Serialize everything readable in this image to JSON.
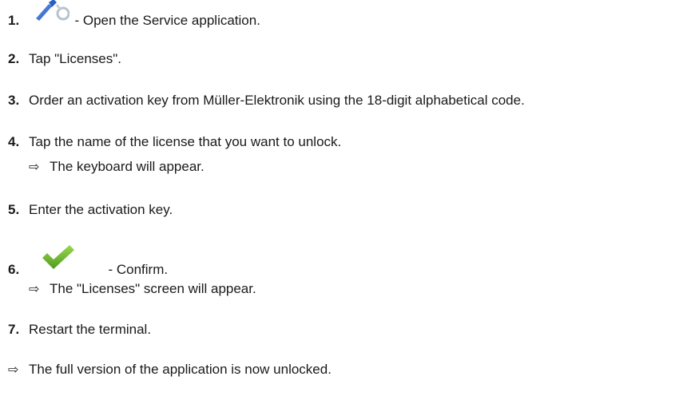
{
  "steps": [
    {
      "num": "1.",
      "text": "- Open the Service application.",
      "icon": "service-wrench-icon"
    },
    {
      "num": "2.",
      "text": "Tap \"Licenses\"."
    },
    {
      "num": "3.",
      "text": "Order an activation key from Müller-Elektronik using the 18-digit alphabetical code."
    },
    {
      "num": "4.",
      "text": "Tap the name of the license that you want to unlock.",
      "result": "The keyboard will appear."
    },
    {
      "num": "5.",
      "text": "Enter the activation key."
    },
    {
      "num": "6.",
      "text": "- Confirm.",
      "icon": "confirm-checkmark-icon",
      "result": "The \"Licenses\" screen will appear."
    },
    {
      "num": "7.",
      "text": "Restart the terminal."
    }
  ],
  "result_arrow": "⇨",
  "final_result": "The full version of the application is now unlocked.",
  "colors": {
    "wrench_blue": "#2a5fc4",
    "check_green": "#6ab82e"
  }
}
